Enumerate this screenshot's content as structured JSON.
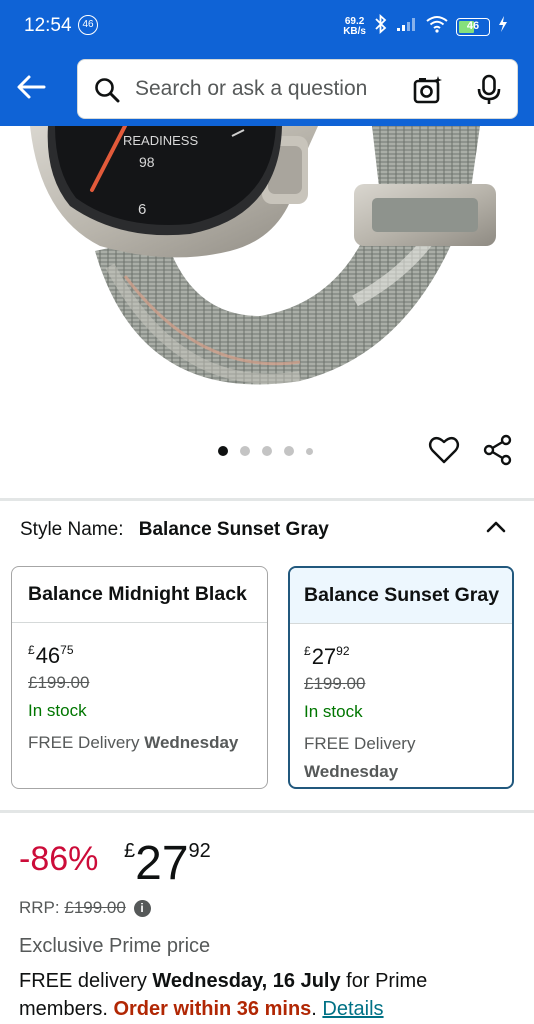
{
  "status_bar": {
    "time": "12:54",
    "network_badge": "46",
    "speed_value": "69.2",
    "speed_unit": "KB/s",
    "battery": "46"
  },
  "header": {
    "search_placeholder": "Search or ask a question"
  },
  "product_image": {
    "watch_label": "READINESS",
    "watch_value": "98",
    "dial_number": "6",
    "carousel_count": 5,
    "carousel_active": 1
  },
  "style": {
    "label": "Style Name:",
    "selected": "Balance Sunset Gray"
  },
  "options": [
    {
      "name": "Balance Midnight Black",
      "currency": "£",
      "whole": "46",
      "fraction": "75",
      "was": "£199.00",
      "stock": "In stock",
      "delivery_prefix": "FREE Delivery",
      "delivery_day": "Wednesday"
    },
    {
      "name": "Balance Sunset Gray",
      "currency": "£",
      "whole": "27",
      "fraction": "92",
      "was": "£199.00",
      "stock": "In stock",
      "delivery_prefix": "FREE Delivery",
      "delivery_day": "Wednesday"
    }
  ],
  "price": {
    "discount": "-86%",
    "currency": "£",
    "whole": "27",
    "fraction": "92",
    "rrp_label": "RRP:",
    "rrp_value": "£199.00",
    "info_glyph": "i",
    "prime_text": "Exclusive Prime price"
  },
  "delivery": {
    "prefix": "FREE delivery ",
    "date": "Wednesday, 16 July",
    "suffix": " for Prime members. ",
    "urgency": "Order within 36 mins",
    "period": ". ",
    "details_link": "Details"
  },
  "colors": {
    "header_bg": "#0f63d6",
    "discount_red": "#cc0c39",
    "in_stock_green": "#007600",
    "link_teal": "#007185",
    "selected_border": "#21587d"
  }
}
